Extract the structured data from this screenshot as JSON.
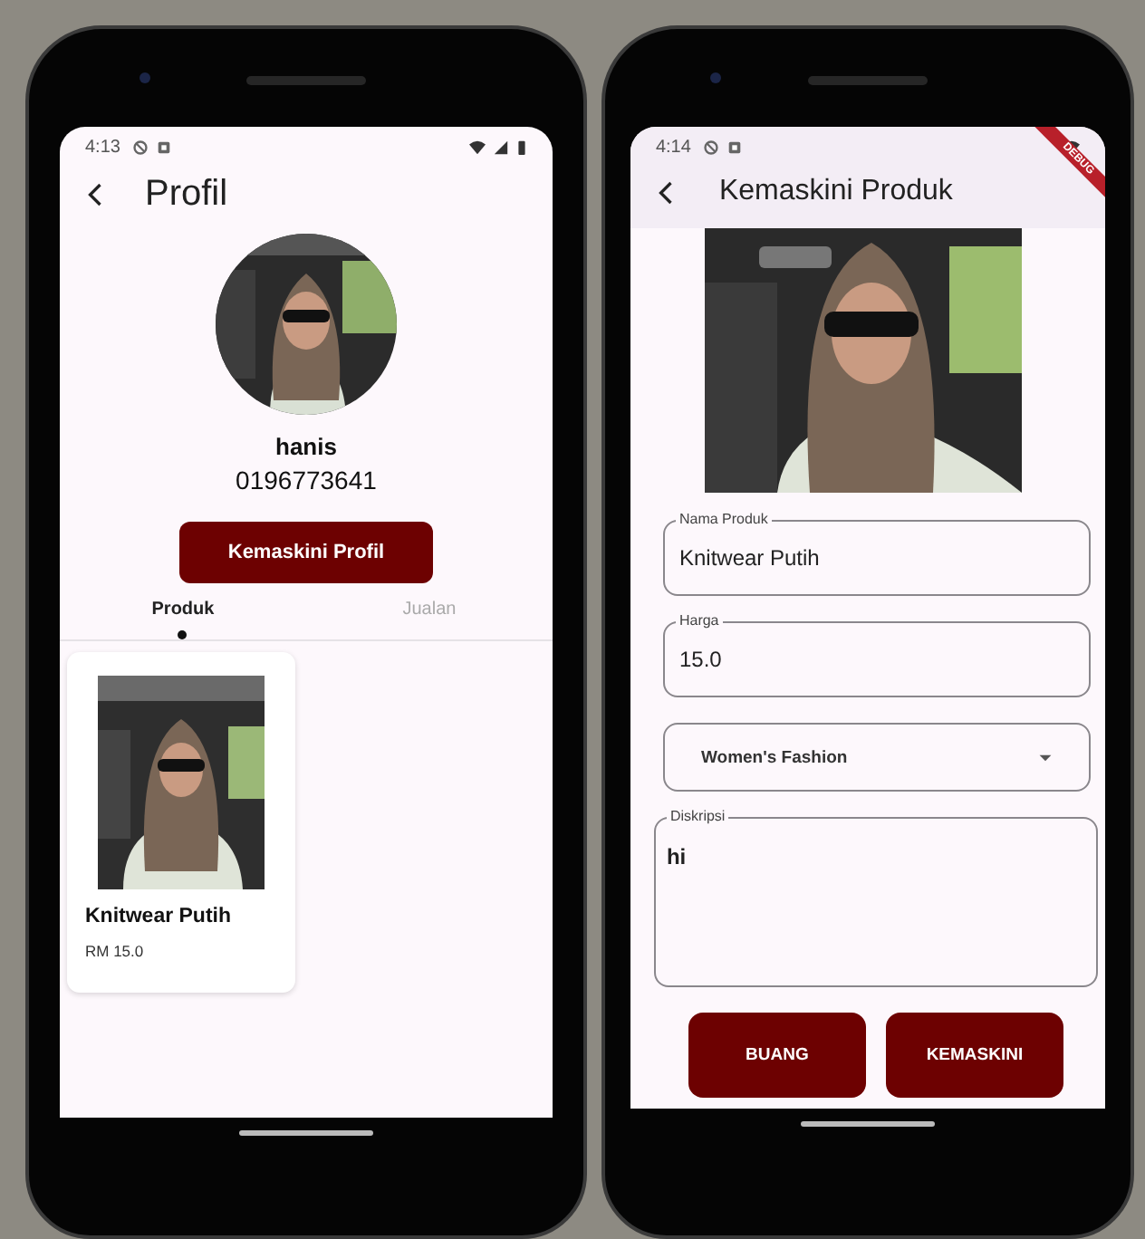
{
  "profile_screen": {
    "status_time": "4:13",
    "title": "Profil",
    "name": "hanis",
    "phone": "0196773641",
    "button": "Kemaskini Profil",
    "tabs": [
      {
        "label": "Produk",
        "selected": true
      },
      {
        "label": "Jualan",
        "selected": false
      }
    ],
    "products": [
      {
        "name": "Knitwear Putih",
        "price": "RM 15.0"
      }
    ]
  },
  "edit_screen": {
    "status_time": "4:14",
    "debug_banner": "DEBUG",
    "title": "Kemaskini Produk",
    "fields": [
      {
        "kind": "text",
        "label": "Nama Produk",
        "value": "Knitwear Putih"
      },
      {
        "kind": "text",
        "label": "Harga",
        "value": "15.0"
      },
      {
        "kind": "dropdown",
        "value": "Women's Fashion"
      },
      {
        "kind": "textarea",
        "label": "Diskripsi",
        "value": "hi"
      }
    ],
    "buttons": [
      "BUANG",
      "KEMASKINI"
    ]
  }
}
